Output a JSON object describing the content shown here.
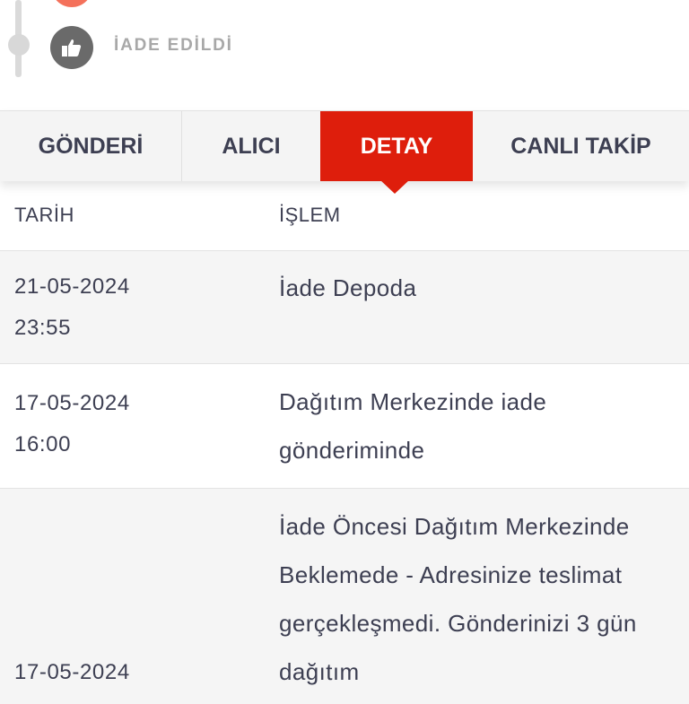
{
  "timeline": {
    "last_step_label": "İADE EDİLDİ"
  },
  "tabs": [
    {
      "label": "GÖNDERİ"
    },
    {
      "label": "ALICI"
    },
    {
      "label": "DETAY",
      "active": true
    },
    {
      "label": "CANLI TAKİP"
    }
  ],
  "table": {
    "headers": {
      "date": "TARİH",
      "operation": "İŞLEM"
    },
    "rows": [
      {
        "date": "21-05-2024",
        "time": "23:55",
        "operation": "İade Depoda"
      },
      {
        "date": "17-05-2024",
        "time": "16:00",
        "operation": "Dağıtım Merkezinde iade gönderiminde"
      },
      {
        "date": "17-05-2024",
        "time": "",
        "operation": "İade Öncesi Dağıtım Merkezinde Beklemede - Adresinize teslimat gerçekleşmedi. Gönderinizi 3 gün dağıtım"
      }
    ]
  },
  "colors": {
    "accent": "#de1e0c",
    "previous_step_icon": "#f4715b",
    "current_step_icon": "#6a6a6a",
    "text": "#3d3f52",
    "muted_label": "#a8a8a8"
  },
  "icons": {
    "step_icon": "thumbs-up-icon"
  }
}
